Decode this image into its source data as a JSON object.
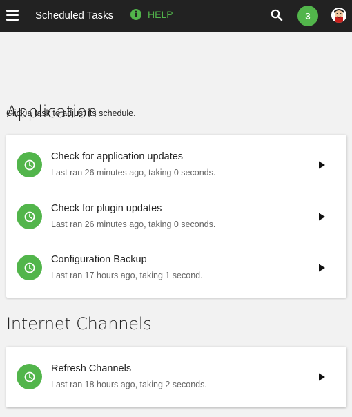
{
  "header": {
    "title": "Scheduled Tasks",
    "help_label": "HELP",
    "notification_count": "3"
  },
  "intro_text": "Click a task to adjust its schedule.",
  "colors": {
    "appbar_bg": "#222222",
    "accent": "#52b54b",
    "page_bg": "#f2f2f2"
  },
  "sections": [
    {
      "title": "Application",
      "tasks": [
        {
          "name": "Check for application updates",
          "detail": "Last ran 26 minutes ago, taking 0 seconds.",
          "icon": "clock-icon"
        },
        {
          "name": "Check for plugin updates",
          "detail": "Last ran 26 minutes ago, taking 0 seconds.",
          "icon": "clock-icon"
        },
        {
          "name": "Configuration Backup",
          "detail": "Last ran 17 hours ago, taking 1 second.",
          "icon": "clock-icon"
        }
      ]
    },
    {
      "title": "Internet Channels",
      "tasks": [
        {
          "name": "Refresh Channels",
          "detail": "Last ran 18 hours ago, taking 2 seconds.",
          "icon": "clock-icon"
        }
      ]
    }
  ]
}
